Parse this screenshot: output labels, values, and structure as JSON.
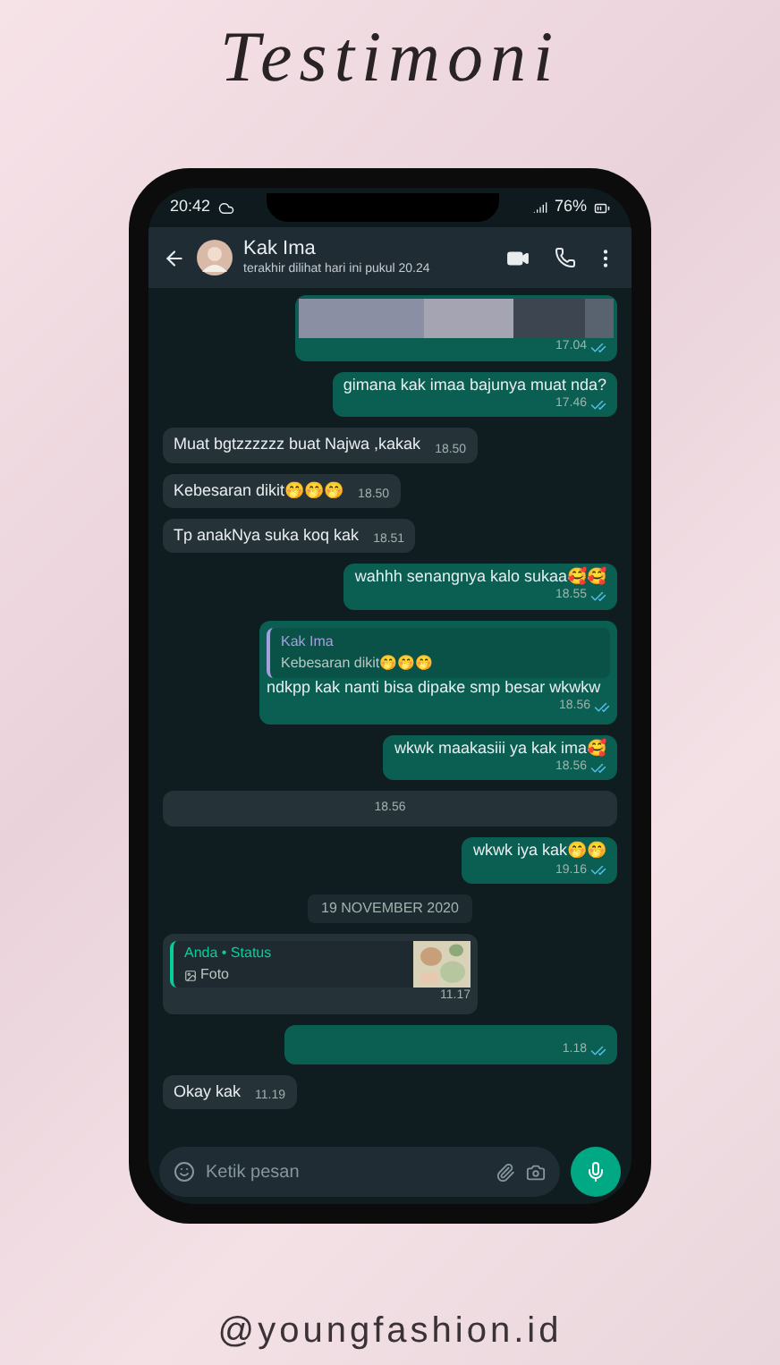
{
  "title": "Testimoni",
  "status_bar": {
    "time": "20:42",
    "battery": "76%"
  },
  "chat_header": {
    "name": "Kak Ima",
    "subtitle": "terakhir dilihat hari ini pukul 20.24"
  },
  "messages": [
    {
      "kind": "image_out",
      "time": "17.04",
      "read": true
    },
    {
      "kind": "out",
      "text": "gimana kak imaa bajunya muat nda?",
      "time": "17.46",
      "read": true
    },
    {
      "kind": "in",
      "text": "Muat bgtzzzzzz buat Najwa ,kakak",
      "time": "18.50"
    },
    {
      "kind": "in",
      "text": "Kebesaran dikit🤭🤭🤭",
      "time": "18.50"
    },
    {
      "kind": "in",
      "text": "Tp anakNya suka koq kak",
      "time": "18.51"
    },
    {
      "kind": "out",
      "text": "wahhh senangnya kalo sukaa🥰🥰",
      "time": "18.55",
      "read": true
    },
    {
      "kind": "quote_out",
      "quote_name": "Kak Ima",
      "quote_text": "Kebesaran dikit🤭🤭🤭",
      "text": "ndkpp kak nanti bisa dipake smp besar wkwkw",
      "time": "18.56",
      "read": true
    },
    {
      "kind": "out",
      "text": "wkwk maakasiii ya kak ima🥰",
      "time": "18.56",
      "read": true
    },
    {
      "kind": "blank_in",
      "time": "18.56"
    },
    {
      "kind": "out",
      "text": "wkwk iya kak🤭🤭",
      "time": "19.16",
      "read": true
    },
    {
      "kind": "date",
      "text": "19 NOVEMBER 2020"
    },
    {
      "kind": "status_in",
      "quote_name": "Anda • Status",
      "quote_text": "Foto",
      "time": "11.17"
    },
    {
      "kind": "blank_out",
      "time": "1.18",
      "read": true
    },
    {
      "kind": "in",
      "text": "Okay kak",
      "time": "11.19"
    }
  ],
  "input": {
    "placeholder": "Ketik pesan"
  },
  "footer": "@youngfashion.id"
}
